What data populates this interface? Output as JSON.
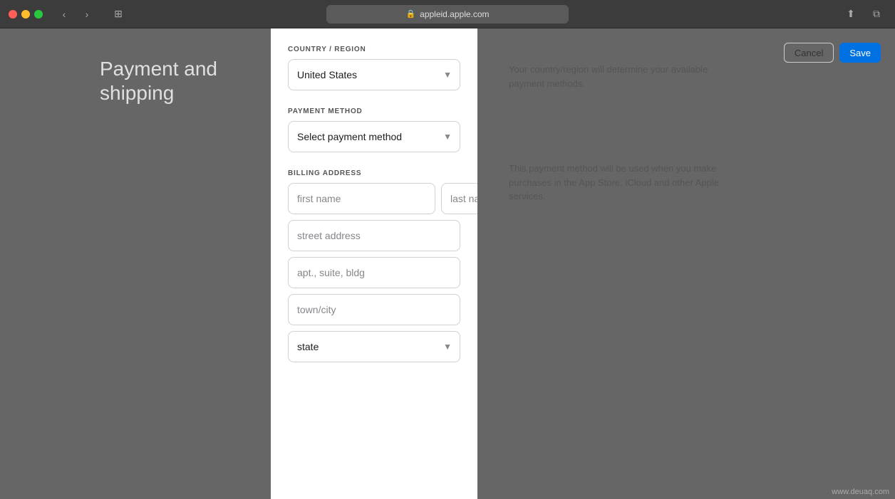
{
  "browser": {
    "url": "appleid.apple.com",
    "tab_icon": "⟳"
  },
  "page": {
    "title_line1": "Payment and",
    "title_line2": "shipping"
  },
  "form": {
    "country_region_label": "COUNTRY / REGION",
    "country_value": "United States",
    "payment_method_label": "PAYMENT METHOD",
    "payment_placeholder": "Select payment method",
    "billing_address_label": "BILLING ADDRESS",
    "first_name_placeholder": "first name",
    "last_name_placeholder": "last name",
    "street_placeholder": "street address",
    "apt_placeholder": "apt., suite, bldg",
    "city_placeholder": "town/city",
    "state_placeholder": "state"
  },
  "info": {
    "country_info": "Your country/region will determine your available payment methods.",
    "payment_info": "This payment method will be used when you make purchases in the App Store, iCloud and other Apple services."
  },
  "actions": {
    "cancel_label": "Cancel",
    "save_label": "Save"
  },
  "watermark": "www.deuaq.com"
}
